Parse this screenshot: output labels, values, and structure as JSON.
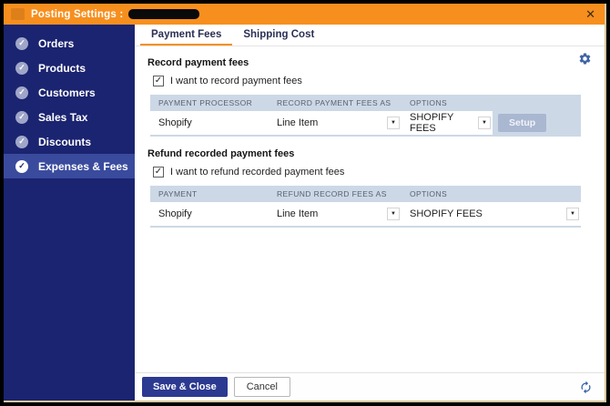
{
  "window": {
    "title": "Posting Settings :",
    "close_glyph": "✕"
  },
  "glyphs": {
    "check": "✓",
    "dropdown_arrow": "▼"
  },
  "sidebar": {
    "items": [
      {
        "label": "Orders",
        "selected": false
      },
      {
        "label": "Products",
        "selected": false
      },
      {
        "label": "Customers",
        "selected": false
      },
      {
        "label": "Sales Tax",
        "selected": false
      },
      {
        "label": "Discounts",
        "selected": false
      },
      {
        "label": "Expenses & Fees",
        "selected": true
      }
    ]
  },
  "tabs": [
    {
      "label": "Payment Fees",
      "active": true
    },
    {
      "label": "Shipping Cost",
      "active": false
    }
  ],
  "record_section": {
    "title": "Record payment fees",
    "checkbox_label": "I want to record payment fees",
    "checkbox_checked": true,
    "table": {
      "headers": [
        "PAYMENT PROCESSOR",
        "RECORD PAYMENT FEES AS",
        "OPTIONS",
        ""
      ],
      "row": {
        "processor": "Shopify",
        "record_as": "Line Item",
        "options": "SHOPIFY FEES",
        "setup_label": "Setup"
      }
    }
  },
  "refund_section": {
    "title": "Refund recorded payment fees",
    "checkbox_label": "I want to refund recorded payment fees",
    "checkbox_checked": true,
    "table": {
      "headers": [
        "PAYMENT",
        "REFUND RECORD FEES AS",
        "OPTIONS"
      ],
      "row": {
        "payment": "Shopify",
        "refund_as": "Line Item",
        "options": "SHOPIFY FEES"
      }
    }
  },
  "footer": {
    "save_label": "Save & Close",
    "cancel_label": "Cancel"
  },
  "colors": {
    "titlebar_orange": "#F78F1E",
    "sidebar_navy": "#1B2470",
    "sidebar_selected": "#3A4B9E",
    "table_header_bg": "#CCD8E6",
    "save_button": "#2B3990",
    "setup_button": "#A9B7D1",
    "gear_blue": "#4064A4",
    "tab_underline": "#F78F1E",
    "window_edge": "#D9C79C"
  }
}
